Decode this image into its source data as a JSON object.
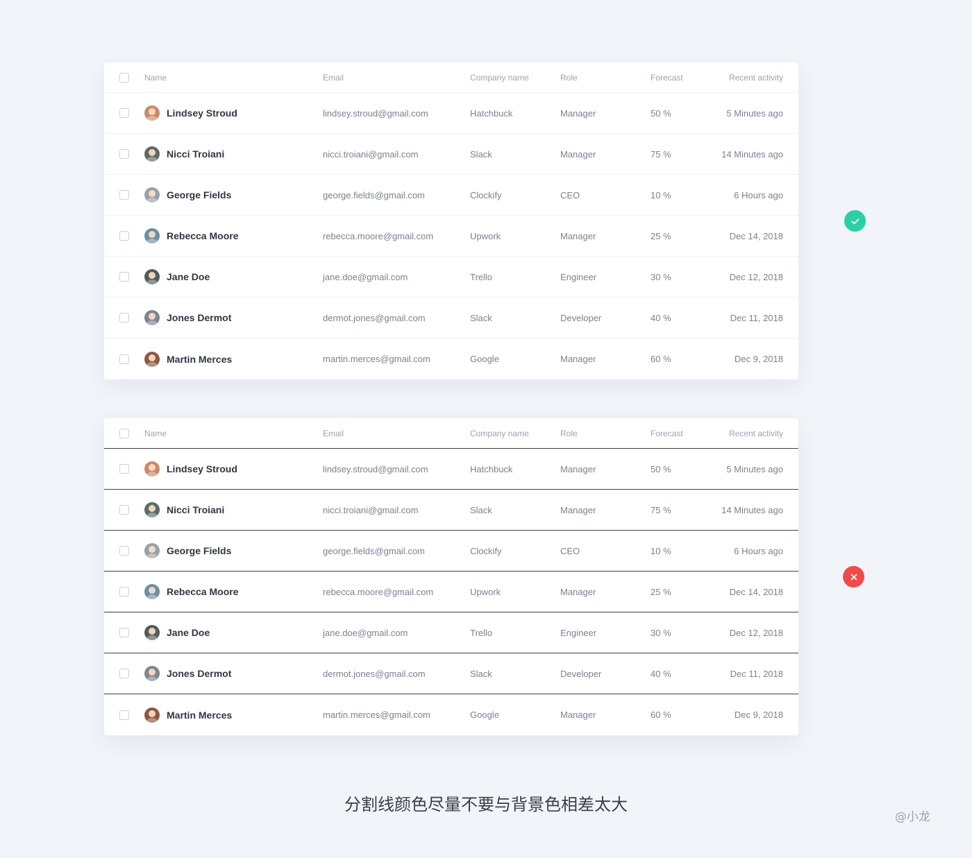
{
  "columns": {
    "name": "Name",
    "email": "Email",
    "company": "Company name",
    "role": "Role",
    "forecast": "Forecast",
    "recent": "Recent activity"
  },
  "rows": [
    {
      "name": "Lindsey Stroud",
      "email": "lindsey.stroud@gmail.com",
      "company": "Hatchbuck",
      "role": "Manager",
      "forecast": "50 %",
      "recent": "5 Minutes ago",
      "avatar_color": "#c98a6b"
    },
    {
      "name": "Nicci Troiani",
      "email": "nicci.troiani@gmail.com",
      "company": "Slack",
      "role": "Manager",
      "forecast": "75 %",
      "recent": "14 Minutes ago",
      "avatar_color": "#5b6b63"
    },
    {
      "name": "George Fields",
      "email": "george.fields@gmail.com",
      "company": "Clockify",
      "role": "CEO",
      "forecast": "10 %",
      "recent": "6 Hours ago",
      "avatar_color": "#9aa0a8"
    },
    {
      "name": "Rebecca Moore",
      "email": "rebecca.moore@gmail.com",
      "company": "Upwork",
      "role": "Manager",
      "forecast": "25 %",
      "recent": "Dec 14, 2018",
      "avatar_color": "#6a8fa6"
    },
    {
      "name": "Jane Doe",
      "email": "jane.doe@gmail.com",
      "company": "Trello",
      "role": "Engineer",
      "forecast": "30 %",
      "recent": "Dec 12, 2018",
      "avatar_color": "#4f5f58"
    },
    {
      "name": "Jones Dermot",
      "email": "dermot.jones@gmail.com",
      "company": "Slack",
      "role": "Developer",
      "forecast": "40 %",
      "recent": "Dec 11, 2018",
      "avatar_color": "#7d8590"
    },
    {
      "name": "Martin Merces",
      "email": "martin.merces@gmail.com",
      "company": "Google",
      "role": "Manager",
      "forecast": "60 %",
      "recent": "Dec 9, 2018",
      "avatar_color": "#8a5a44"
    }
  ],
  "badges": {
    "good_color": "#2ad0a3",
    "bad_color": "#f04a4a",
    "good_icon": "check-icon",
    "bad_icon": "close-icon"
  },
  "caption": "分割线颜色尽量不要与背景色相差太大",
  "watermark": "@小龙"
}
